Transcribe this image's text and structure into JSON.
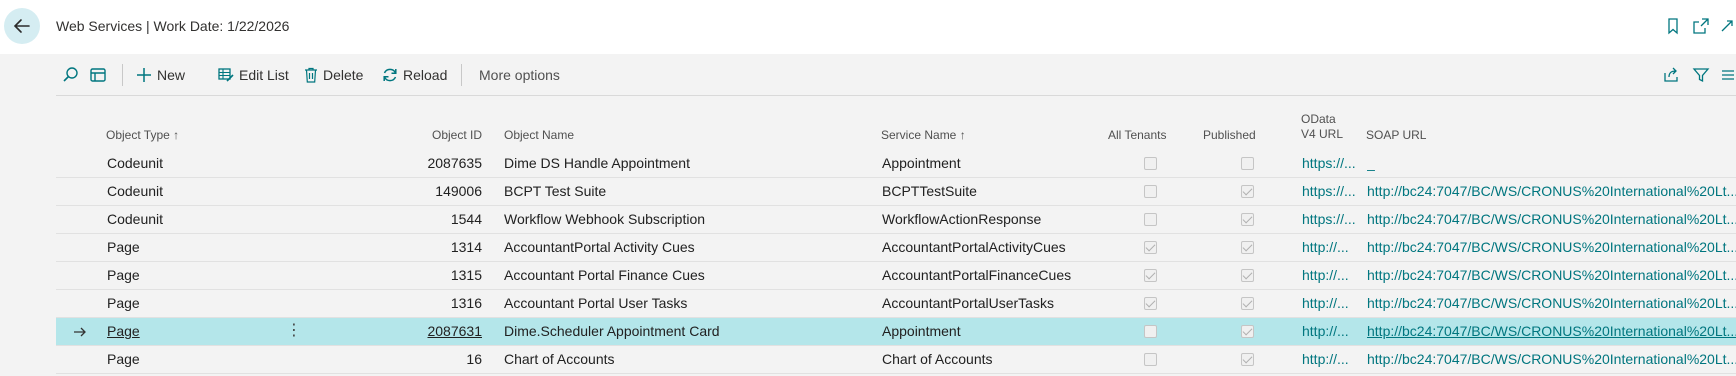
{
  "header": {
    "title": "Web Services | Work Date: 1/22/2026"
  },
  "actions": {
    "new": "New",
    "edit_list": "Edit List",
    "delete": "Delete",
    "reload": "Reload",
    "more": "More options"
  },
  "columns": {
    "object_type": "Object Type",
    "object_id": "Object ID",
    "object_name": "Object Name",
    "service_name": "Service Name",
    "all_tenants": "All Tenants",
    "published": "Published",
    "odata_line1": "OData",
    "odata_line2": "V4 URL",
    "soap_url": "SOAP URL",
    "sort_indicator": "↑"
  },
  "rows": [
    {
      "type": "Codeunit",
      "id": "2087635",
      "name": "Dime DS Handle Appointment",
      "service": "Appointment",
      "all_tenants": false,
      "published": false,
      "odata": "https://...",
      "soap": "_"
    },
    {
      "type": "Codeunit",
      "id": "149006",
      "name": "BCPT Test Suite",
      "service": "BCPTTestSuite",
      "all_tenants": false,
      "published": true,
      "odata": "https://...",
      "soap": "http://bc24:7047/BC/WS/CRONUS%20International%20Lt..."
    },
    {
      "type": "Codeunit",
      "id": "1544",
      "name": "Workflow Webhook Subscription",
      "service": "WorkflowActionResponse",
      "all_tenants": false,
      "published": true,
      "odata": "https://...",
      "soap": "http://bc24:7047/BC/WS/CRONUS%20International%20Lt..."
    },
    {
      "type": "Page",
      "id": "1314",
      "name": "AccountantPortal Activity Cues",
      "service": "AccountantPortalActivityCues",
      "all_tenants": true,
      "published": true,
      "odata": "http://...",
      "soap": "http://bc24:7047/BC/WS/CRONUS%20International%20Lt..."
    },
    {
      "type": "Page",
      "id": "1315",
      "name": "Accountant Portal Finance Cues",
      "service": "AccountantPortalFinanceCues",
      "all_tenants": true,
      "published": true,
      "odata": "http://...",
      "soap": "http://bc24:7047/BC/WS/CRONUS%20International%20Lt..."
    },
    {
      "type": "Page",
      "id": "1316",
      "name": "Accountant Portal User Tasks",
      "service": "AccountantPortalUserTasks",
      "all_tenants": true,
      "published": true,
      "odata": "http://...",
      "soap": "http://bc24:7047/BC/WS/CRONUS%20International%20Lt..."
    },
    {
      "type": "Page",
      "id": "2087631",
      "name": "Dime.Scheduler Appointment Card",
      "service": "Appointment",
      "all_tenants": false,
      "published": true,
      "odata": "http://...",
      "soap": "http://bc24:7047/BC/WS/CRONUS%20International%20Lt...",
      "selected": true
    },
    {
      "type": "Page",
      "id": "16",
      "name": "Chart of Accounts",
      "service": "Chart of Accounts",
      "all_tenants": false,
      "published": true,
      "odata": "http://...",
      "soap": "http://bc24:7047/BC/WS/CRONUS%20International%20Lt..."
    }
  ]
}
